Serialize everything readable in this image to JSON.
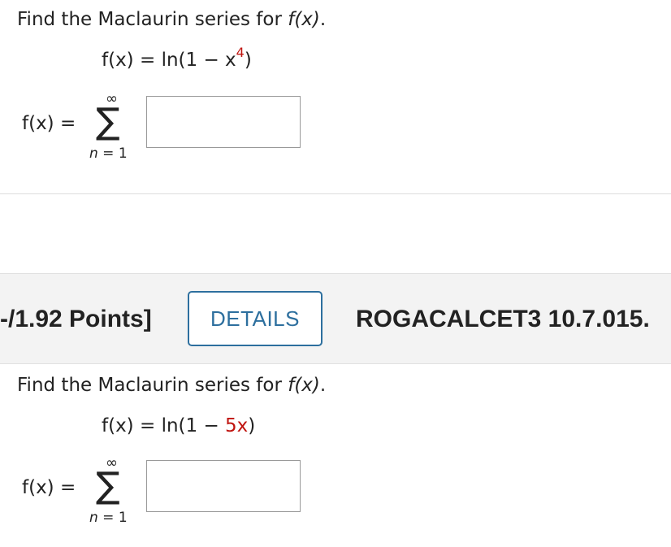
{
  "problem1": {
    "prompt_text": "Find the Maclaurin series for ",
    "prompt_fx": "f(x)",
    "prompt_period": ".",
    "function_lhs": "f(x)",
    "function_eq": " = ",
    "function_rhs_start": "ln(1 − x",
    "function_exponent": "4",
    "function_rhs_end": ")",
    "series_lhs": "f(x)",
    "series_eq": " = ",
    "sigma": "∑",
    "upper_limit": "∞",
    "lower_limit_var": "n",
    "lower_limit_rest": " = 1",
    "answer_value": ""
  },
  "header": {
    "points": "-/1.92 Points]",
    "details_label": "DETAILS",
    "problem_id": "ROGACALCET3 10.7.015."
  },
  "problem2": {
    "prompt_text": "Find the Maclaurin series for ",
    "prompt_fx": "f(x)",
    "prompt_period": ".",
    "function_lhs": "f(x)",
    "function_eq": " = ",
    "function_rhs_start": "ln(1 − ",
    "function_rhs_red": "5x",
    "function_rhs_end": ")",
    "series_lhs": "f(x)",
    "series_eq": " = ",
    "sigma": "∑",
    "upper_limit": "∞",
    "lower_limit_var": "n",
    "lower_limit_rest": " = 1",
    "answer_value": ""
  },
  "colors": {
    "accent": "#2d6f9e",
    "highlight": "#c0140f",
    "header_band": "#f3f3f3"
  }
}
